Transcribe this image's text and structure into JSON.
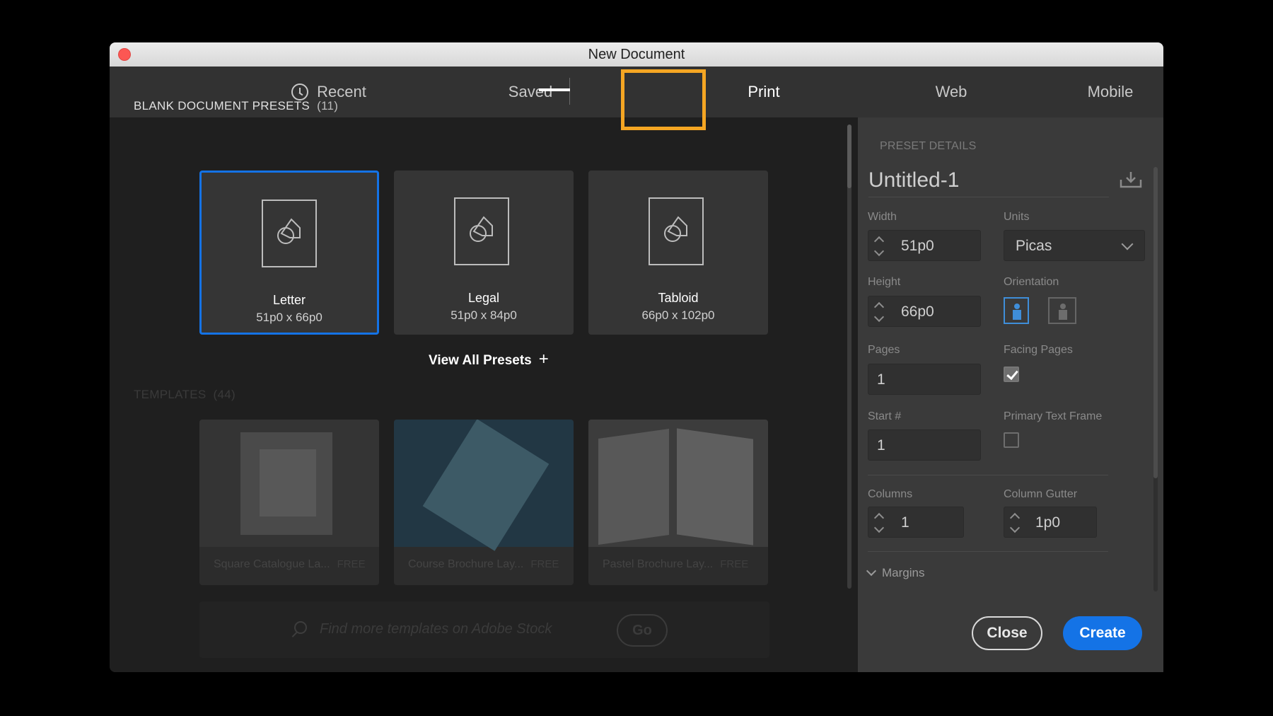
{
  "window": {
    "title": "New Document"
  },
  "tabs": {
    "recent": "Recent",
    "saved": "Saved",
    "print": "Print",
    "web": "Web",
    "mobile": "Mobile"
  },
  "blank_presets": {
    "heading": "BLANK DOCUMENT PRESETS",
    "count": "(11)",
    "items": [
      {
        "name": "Letter",
        "size": "51p0 x 66p0",
        "selected": true
      },
      {
        "name": "Legal",
        "size": "51p0 x 84p0",
        "selected": false
      },
      {
        "name": "Tabloid",
        "size": "66p0 x 102p0",
        "selected": false
      }
    ],
    "view_all": "View All Presets"
  },
  "templates": {
    "heading": "TEMPLATES",
    "count": "(44)",
    "items": [
      {
        "name": "Square Catalogue La...",
        "badge": "FREE"
      },
      {
        "name": "Course Brochure Lay...",
        "badge": "FREE"
      },
      {
        "name": "Pastel Brochure Lay...",
        "badge": "FREE"
      }
    ]
  },
  "search": {
    "placeholder": "Find more templates on Adobe Stock",
    "go_label": "Go"
  },
  "preset_details": {
    "heading": "PRESET DETAILS",
    "doc_name": "Untitled-1",
    "width_label": "Width",
    "width_value": "51p0",
    "units_label": "Units",
    "units_value": "Picas",
    "height_label": "Height",
    "height_value": "66p0",
    "orientation_label": "Orientation",
    "orientation": "portrait",
    "pages_label": "Pages",
    "pages_value": "1",
    "facing_pages_label": "Facing Pages",
    "facing_pages_checked": true,
    "start_label": "Start #",
    "start_value": "1",
    "primary_text_frame_label": "Primary Text Frame",
    "primary_text_frame_checked": false,
    "columns_label": "Columns",
    "columns_value": "1",
    "column_gutter_label": "Column Gutter",
    "column_gutter_value": "1p0",
    "margins_label": "Margins"
  },
  "buttons": {
    "close": "Close",
    "create": "Create"
  },
  "colors": {
    "accent": "#1473e6",
    "highlight": "#f5a623",
    "close_dot": "#fc5753"
  }
}
